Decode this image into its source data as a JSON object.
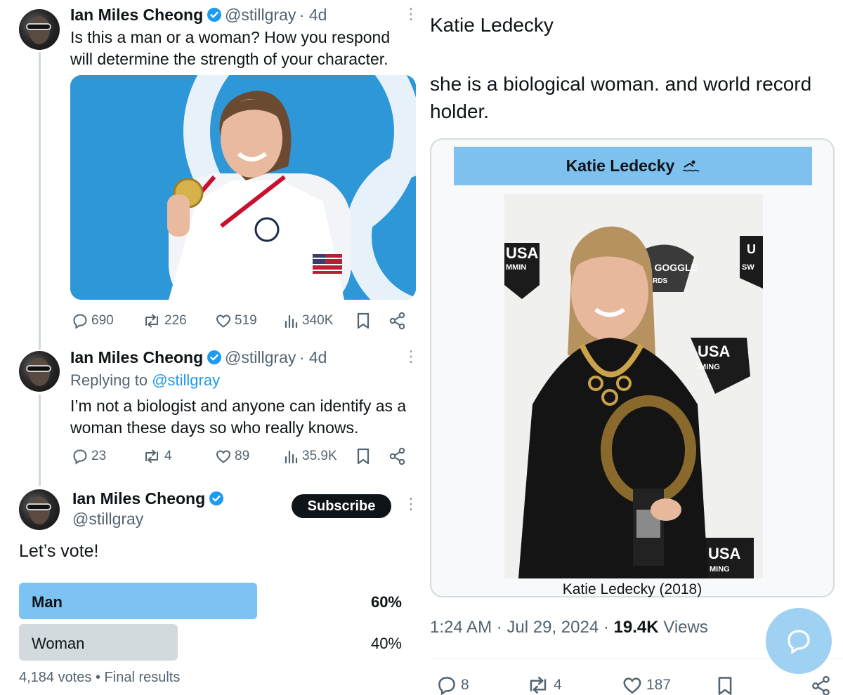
{
  "tweets": [
    {
      "name": "Ian Miles Cheong",
      "handle": "@stillgray",
      "time": "· 4d",
      "text": "Is this a man or a woman? How you respond will determine the strength of your character.",
      "stats": {
        "replies": "690",
        "reposts": "226",
        "likes": "519",
        "views": "340K"
      }
    },
    {
      "name": "Ian Miles Cheong",
      "handle": "@stillgray",
      "time": "· 4d",
      "replying_prefix": "Replying to",
      "replying_handle": "@stillgray",
      "text": "I’m not a biologist and anyone can identify as a woman these days so who really knows.",
      "stats": {
        "replies": "23",
        "reposts": "4",
        "likes": "89",
        "views": "35.9K"
      }
    },
    {
      "name": "Ian Miles Cheong",
      "handle": "@stillgray",
      "subscribe_label": "Subscribe",
      "text": "Let’s vote!",
      "poll": {
        "options": [
          {
            "label": "Man",
            "percent": "60%",
            "fraction": 0.6,
            "winner": true
          },
          {
            "label": "Woman",
            "percent": "40%",
            "fraction": 0.4,
            "winner": false
          }
        ],
        "votes": "4,184 votes",
        "status": "Final results"
      }
    }
  ],
  "reply": {
    "line1": "Katie Ledecky",
    "line2": "she is a biological woman. and world record holder.",
    "card": {
      "header": "Katie Ledecky",
      "caption": "Katie Ledecky (2018)",
      "backdrop_texts": [
        "USA",
        "MMIN",
        "DEN GOGGLE",
        "WARDS",
        "USA",
        "IMING",
        "U",
        "SW",
        "USA",
        "MING"
      ]
    },
    "time": "1:24 AM",
    "date": "Jul 29, 2024",
    "views_count": "19.4K",
    "views_label": "Views",
    "stats": {
      "replies": "8",
      "reposts": "4",
      "likes": "187"
    }
  },
  "colors": {
    "accent": "#1d9bf0",
    "poll_winner": "#7cc2f2",
    "poll_other": "#d3dade",
    "card_header": "#7ec1ee",
    "media_bg": "#2e97d8"
  },
  "icons": [
    "verified-badge-icon",
    "more-dots-icon",
    "reply-icon",
    "repost-icon",
    "like-icon",
    "views-icon",
    "bookmark-icon",
    "share-icon",
    "swimmer-icon",
    "compose-icon"
  ]
}
